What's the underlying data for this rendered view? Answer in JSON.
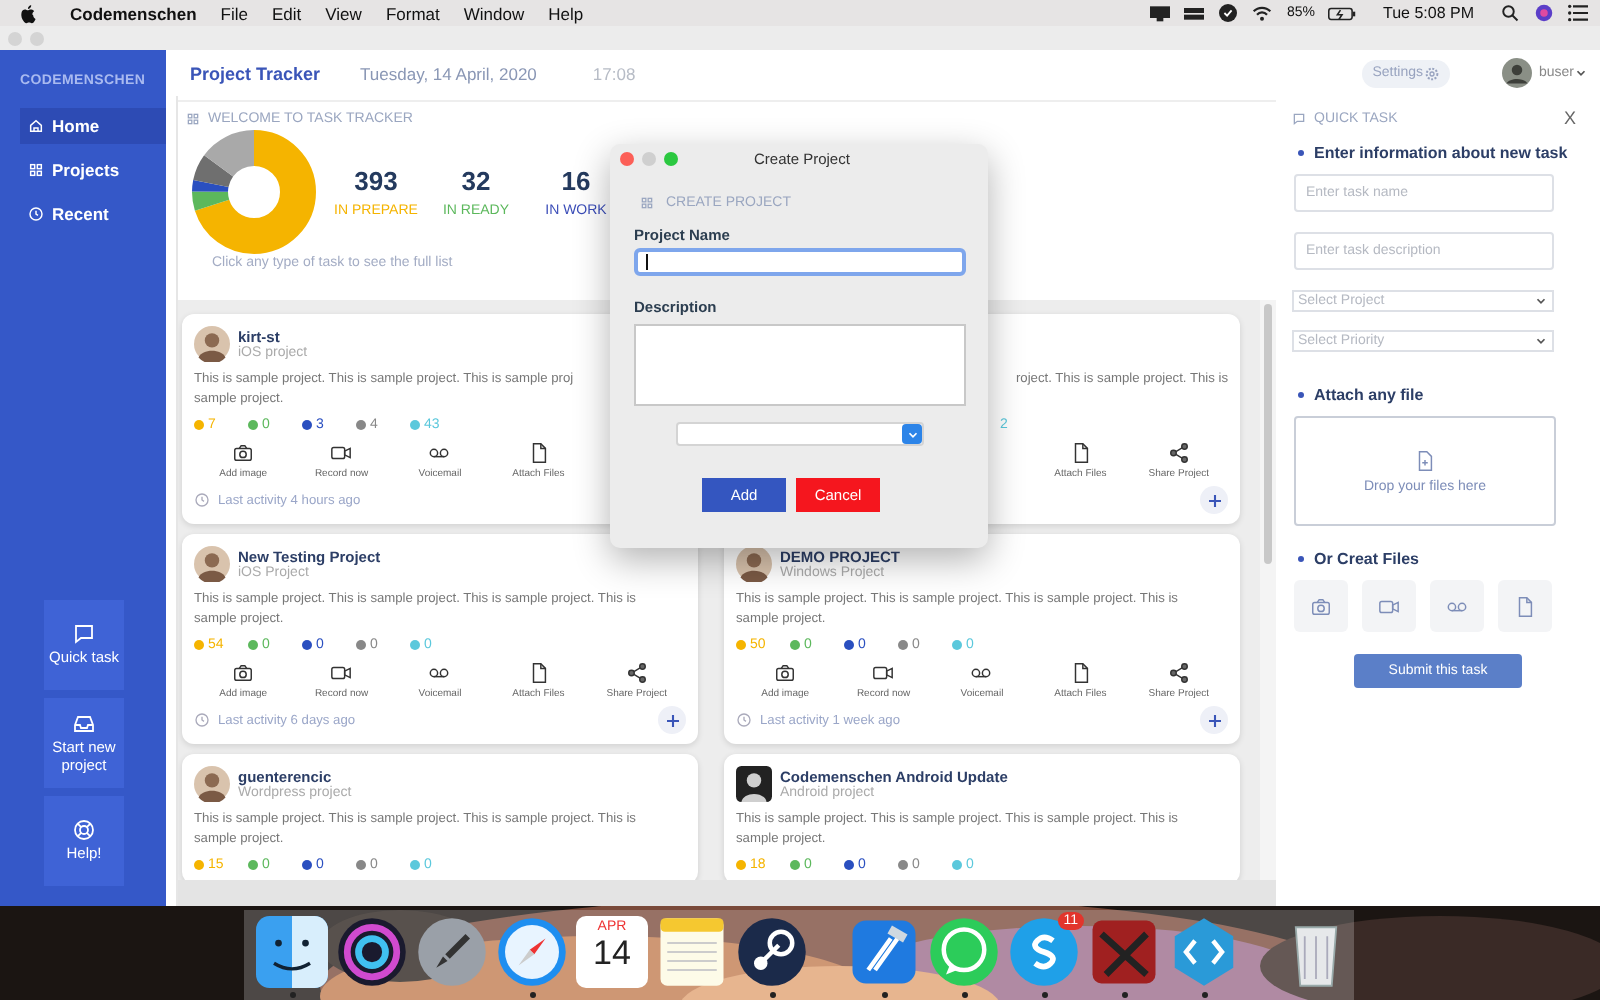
{
  "menu_bar": {
    "app": "Codemenschen",
    "menus": [
      "File",
      "Edit",
      "View",
      "Format",
      "Window",
      "Help"
    ],
    "battery": "85%",
    "clock": "Tue 5:08 PM"
  },
  "sidebar": {
    "brand": "CODEMENSCHEN",
    "items": [
      {
        "label": "Home",
        "kind": "home",
        "selected": true
      },
      {
        "label": "Projects",
        "kind": "grid",
        "selected": false
      },
      {
        "label": "Recent",
        "kind": "clock",
        "selected": false
      }
    ],
    "actions": [
      {
        "label": "Quick task",
        "kind": "chat"
      },
      {
        "label": "Start new project",
        "kind": "inbox"
      },
      {
        "label": "Help!",
        "kind": "lifebuoy"
      }
    ]
  },
  "header": {
    "title": "Project Tracker",
    "date": "Tuesday, 14 April, 2020",
    "time": "17:08",
    "settings": "Settings",
    "user": "buser"
  },
  "welcome": {
    "title": "WELCOME TO TASK TRACKER",
    "stats": [
      {
        "value": "393",
        "label": "IN PREPARE",
        "color": "#f5b400"
      },
      {
        "value": "32",
        "label": "IN READY",
        "color": "#5cb85c"
      },
      {
        "value": "16",
        "label": "IN WORK",
        "color": "#3b4db8"
      }
    ],
    "hint": "Click any type of task to see the full list"
  },
  "cards": [
    {
      "covered": false,
      "avatar": {
        "kind": "light"
      },
      "title": "kirt-st",
      "subtitle": "iOS project",
      "description": [
        "This is sample project. This is sample project. This is sample proj",
        "sample project."
      ],
      "counts": [
        {
          "value": "7",
          "color": "#f5b400"
        },
        {
          "value": "0",
          "color": "#5cb85c"
        },
        {
          "value": "3",
          "color": "#2a4fc0"
        },
        {
          "value": "4",
          "color": "#888888"
        },
        {
          "value": "43",
          "color": "#5bc8dc"
        }
      ],
      "actions": [
        {
          "label": "Add image",
          "kind": "camera"
        },
        {
          "label": "Record now",
          "kind": "video"
        },
        {
          "label": "Voicemail",
          "kind": "voicemail"
        },
        {
          "label": "Attach Files",
          "kind": "file"
        }
      ],
      "activity": "Last activity 4 hours ago",
      "add_button": false
    },
    {
      "covered": true,
      "description": [
        "roject. This is sample project. This is"
      ],
      "counts": [
        {
          "value": "2",
          "color": "#5bc8dc"
        }
      ],
      "actions": [
        {
          "label": "Attach Files",
          "kind": "file"
        },
        {
          "label": "Share Project",
          "kind": "share"
        }
      ],
      "add_button": true
    },
    {
      "covered": false,
      "avatar": {
        "kind": "light"
      },
      "title": "New Testing Project",
      "subtitle": "iOS Project",
      "description": [
        "This is sample project. This is sample project. This is sample project. This is",
        "sample project."
      ],
      "counts": [
        {
          "value": "54",
          "color": "#f5b400"
        },
        {
          "value": "0",
          "color": "#5cb85c"
        },
        {
          "value": "0",
          "color": "#2a4fc0"
        },
        {
          "value": "0",
          "color": "#888888"
        },
        {
          "value": "0",
          "color": "#5bc8dc"
        }
      ],
      "actions": [
        {
          "label": "Add image",
          "kind": "camera"
        },
        {
          "label": "Record now",
          "kind": "video"
        },
        {
          "label": "Voicemail",
          "kind": "voicemail"
        },
        {
          "label": "Attach Files",
          "kind": "file"
        },
        {
          "label": "Share Project",
          "kind": "share"
        }
      ],
      "activity": "Last activity 6 days ago",
      "add_button": true
    },
    {
      "covered": false,
      "avatar": {
        "kind": "light"
      },
      "title": "DEMO PROJECT",
      "subtitle": "Windows Project",
      "description": [
        "This is sample project. This is sample project. This is sample project. This is",
        "sample project."
      ],
      "counts": [
        {
          "value": "50",
          "color": "#f5b400"
        },
        {
          "value": "0",
          "color": "#5cb85c"
        },
        {
          "value": "0",
          "color": "#2a4fc0"
        },
        {
          "value": "0",
          "color": "#888888"
        },
        {
          "value": "0",
          "color": "#5bc8dc"
        }
      ],
      "actions": [
        {
          "label": "Add image",
          "kind": "camera"
        },
        {
          "label": "Record now",
          "kind": "video"
        },
        {
          "label": "Voicemail",
          "kind": "voicemail"
        },
        {
          "label": "Attach Files",
          "kind": "file"
        },
        {
          "label": "Share Project",
          "kind": "share"
        }
      ],
      "activity": "Last activity 1 week ago",
      "add_button": true
    },
    {
      "covered": false,
      "avatar": {
        "kind": "light"
      },
      "title": "guenterencic",
      "subtitle": "Wordpress project",
      "description": [
        "This is sample project. This is sample project. This is sample project. This is",
        "sample project."
      ],
      "counts": [
        {
          "value": "15",
          "color": "#f5b400"
        },
        {
          "value": "0",
          "color": "#5cb85c"
        },
        {
          "value": "0",
          "color": "#2a4fc0"
        },
        {
          "value": "0",
          "color": "#888888"
        },
        {
          "value": "0",
          "color": "#5bc8dc"
        }
      ],
      "add_button": false
    },
    {
      "covered": false,
      "avatar": {
        "kind": "dark"
      },
      "title": "Codemenschen Android Update",
      "subtitle": "Android project",
      "description": [
        "This is sample project. This is sample project. This is sample project. This is",
        "sample project."
      ],
      "counts": [
        {
          "value": "18",
          "color": "#f5b400"
        },
        {
          "value": "0",
          "color": "#5cb85c"
        },
        {
          "value": "0",
          "color": "#2a4fc0"
        },
        {
          "value": "0",
          "color": "#888888"
        },
        {
          "value": "0",
          "color": "#5bc8dc"
        }
      ],
      "add_button": false
    }
  ],
  "quick_task": {
    "title": "QUICK TASK",
    "close": "X",
    "section": "Enter information about new task",
    "name_placeholder": "Enter task name",
    "description_placeholder": "Enter task description",
    "selects": [
      "Select Project",
      "Select Priority"
    ],
    "attach_heading": "Attach any file",
    "dropzone": "Drop your files here",
    "create_heading": "Or Creat Files",
    "create_buttons": [
      {
        "kind": "camera"
      },
      {
        "kind": "video"
      },
      {
        "kind": "voicemail"
      },
      {
        "kind": "file"
      }
    ],
    "submit": "Submit this task"
  },
  "dialog": {
    "title": "Create Project",
    "heading": "CREATE PROJECT",
    "name_label": "Project Name",
    "description_label": "Description",
    "buttons": [
      {
        "label": "Add",
        "kind": "primary"
      },
      {
        "label": "Cancel",
        "kind": "danger"
      }
    ]
  },
  "dock": {
    "apps": [
      {
        "kind": "finder",
        "running": true
      },
      {
        "kind": "siri",
        "running": false
      },
      {
        "kind": "launchpad",
        "running": false
      },
      {
        "kind": "safari",
        "running": true
      },
      {
        "kind": "calendar",
        "month": "APR",
        "day": "14",
        "running": false
      },
      {
        "kind": "notes",
        "running": false
      },
      {
        "kind": "steam",
        "running": true
      },
      {
        "kind": "separator"
      },
      {
        "kind": "xcode",
        "running": true
      },
      {
        "kind": "whatsapp",
        "running": true
      },
      {
        "kind": "skype",
        "badge": "11",
        "running": true
      },
      {
        "kind": "game",
        "running": true
      },
      {
        "kind": "code",
        "running": true
      },
      {
        "kind": "separator"
      },
      {
        "kind": "trash",
        "running": false
      }
    ]
  }
}
